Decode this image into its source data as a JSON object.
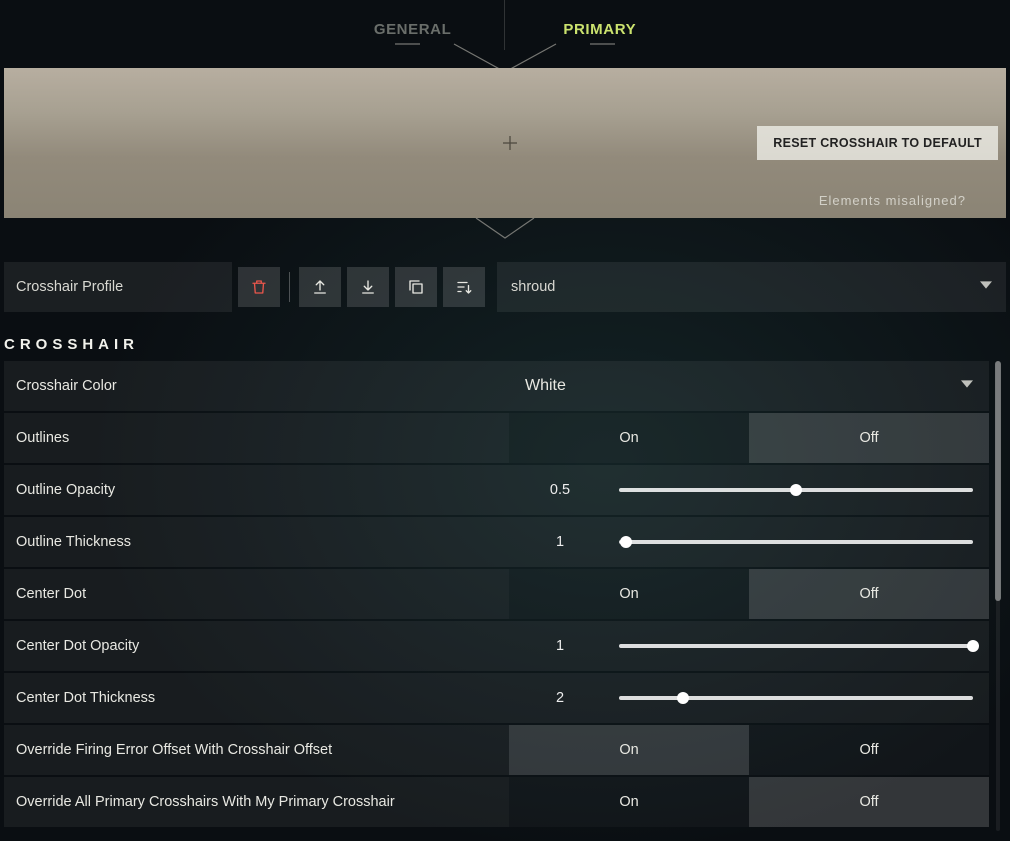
{
  "tabs": {
    "general": "GENERAL",
    "primary": "PRIMARY",
    "active": "primary"
  },
  "preview": {
    "reset_label": "RESET CROSSHAIR TO DEFAULT",
    "misaligned_label": "Elements misaligned?"
  },
  "profile": {
    "label": "Crosshair Profile",
    "selected": "shroud"
  },
  "section_header": "CROSSHAIR",
  "settings": {
    "crosshair_color": {
      "label": "Crosshair Color",
      "value": "White"
    },
    "outlines": {
      "label": "Outlines",
      "on": "On",
      "off": "Off",
      "value": "On"
    },
    "outline_opacity": {
      "label": "Outline Opacity",
      "value": "0.5",
      "pct": 50
    },
    "outline_thickness": {
      "label": "Outline Thickness",
      "value": "1",
      "pct": 2
    },
    "center_dot": {
      "label": "Center Dot",
      "on": "On",
      "off": "Off",
      "value": "Off"
    },
    "center_dot_opacity": {
      "label": "Center Dot Opacity",
      "value": "1",
      "pct": 100
    },
    "center_dot_thickness": {
      "label": "Center Dot Thickness",
      "value": "2",
      "pct": 18
    },
    "override_firing": {
      "label": "Override Firing Error Offset With Crosshair Offset",
      "on": "On",
      "off": "Off",
      "value": "On"
    },
    "override_all": {
      "label": "Override All Primary Crosshairs With My Primary Crosshair",
      "on": "On",
      "off": "Off",
      "value": "Off"
    }
  }
}
